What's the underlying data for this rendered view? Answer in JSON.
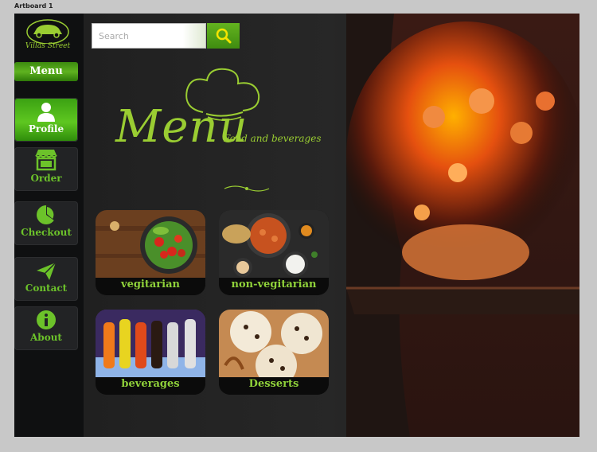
{
  "artboard": {
    "label": "Artboard 1"
  },
  "brand": {
    "name": "Villas Street"
  },
  "sidebar": {
    "menu_label": "Menu",
    "items": [
      {
        "label": "Profile",
        "icon": "user-icon"
      },
      {
        "label": "Order",
        "icon": "storefront-icon"
      },
      {
        "label": "Checkout",
        "icon": "pie-chart-icon"
      },
      {
        "label": "Contact",
        "icon": "paper-plane-icon"
      },
      {
        "label": "About",
        "icon": "info-icon"
      }
    ]
  },
  "search": {
    "placeholder": "Search"
  },
  "hero": {
    "title": "Menu",
    "subtitle": "Food and beverages"
  },
  "categories": [
    {
      "label": "vegitarian"
    },
    {
      "label": "non-vegitarian"
    },
    {
      "label": "beverages"
    },
    {
      "label": "Desserts"
    }
  ],
  "colors": {
    "accent": "#9acd32",
    "active": "#4fb81a",
    "sidebar": "#0f1011",
    "background": "#1e1e1e"
  }
}
